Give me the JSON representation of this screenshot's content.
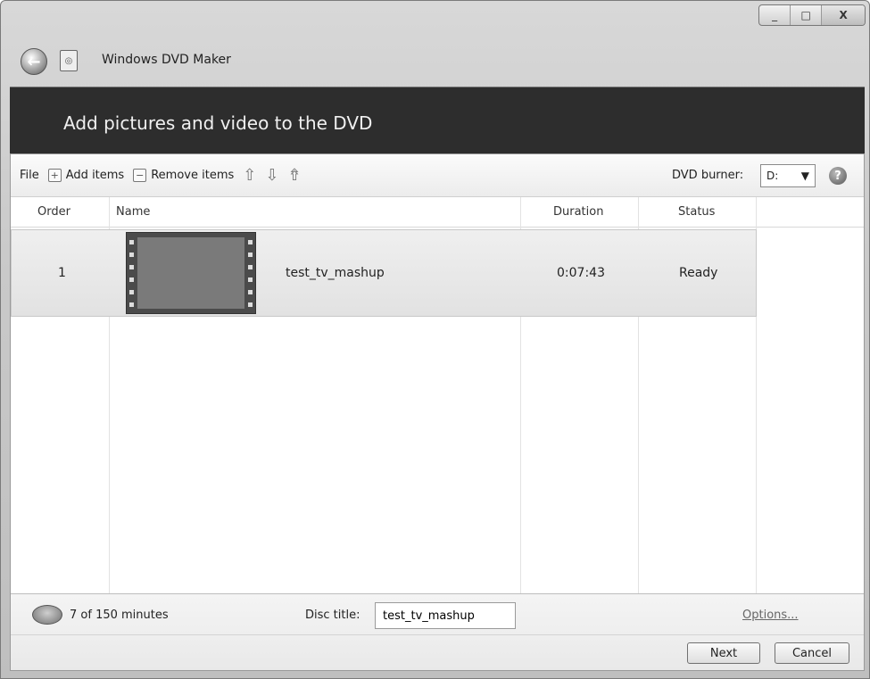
{
  "window": {
    "title": "Windows DVD Maker",
    "controls": {
      "minimize": "_",
      "maximize": "□",
      "close": "X"
    }
  },
  "header": {
    "heading": "Add pictures and video to the DVD"
  },
  "toolbar": {
    "file": "File",
    "add_items": "Add items",
    "remove_items": "Remove items",
    "dvd_burner_label": "DVD burner:",
    "dvd_burner_value": "D:"
  },
  "columns": {
    "order": "Order",
    "name": "Name",
    "duration": "Duration",
    "status": "Status"
  },
  "items": [
    {
      "order": "1",
      "name": "test_tv_mashup",
      "duration": "0:07:43",
      "status": "Ready"
    }
  ],
  "footer": {
    "minutes": "7 of 150 minutes",
    "disc_title_label": "Disc title:",
    "disc_title_value": "test_tv_mashup",
    "options": "Options...",
    "next": "Next",
    "cancel": "Cancel"
  },
  "icons": [
    "back-arrow-icon",
    "dvd-maker-app-icon",
    "add-items-icon",
    "remove-items-icon",
    "move-up-icon",
    "move-down-icon",
    "move-to-top-icon",
    "help-icon",
    "disc-capacity-icon",
    "video-film-icon"
  ]
}
